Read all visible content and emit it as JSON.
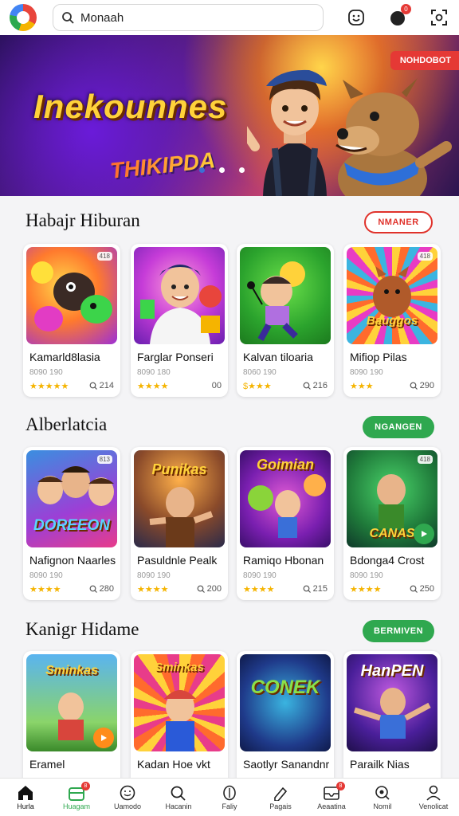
{
  "search": {
    "value": "Monaah"
  },
  "header": {
    "badge_count": "0"
  },
  "hero": {
    "title": "Inekounnes",
    "subtitle": "THIKIPDA",
    "tag": "NOHDOBOT"
  },
  "sections": [
    {
      "title": "Habajr Hiburan",
      "button": "NMANER",
      "button_style": "red",
      "cards": [
        {
          "title": "Kamarld8lasia",
          "meta": "8090 190",
          "stars": "★★★★★",
          "views": "214",
          "corner": "418"
        },
        {
          "title": "Farglar Ponseri",
          "meta": "8090 180",
          "stars": "★★★★",
          "views": "00",
          "corner": ""
        },
        {
          "title": "Kalvan tiloaria",
          "meta": "8060 190",
          "stars": "$★★★",
          "views": "216",
          "corner": ""
        },
        {
          "title": "Mifiop Pilas",
          "meta": "8090 190",
          "stars": "★★★",
          "views": "290",
          "corner": "418"
        }
      ]
    },
    {
      "title": "Alberlatcia",
      "button": "NGANGEN",
      "button_style": "green",
      "cards": [
        {
          "title": "Nafignon Naarles",
          "meta": "8090 190",
          "stars": "★★★★",
          "views": "280",
          "corner": "813"
        },
        {
          "title": "Pasuldnle Pealk",
          "meta": "8090 190",
          "stars": "★★★★",
          "views": "200",
          "corner": ""
        },
        {
          "title": "Ramiqo Hbonan",
          "meta": "8090 190",
          "stars": "★★★★",
          "views": "215",
          "corner": ""
        },
        {
          "title": "Bdonga4 Crost",
          "meta": "8090 190",
          "stars": "★★★★",
          "views": "250",
          "corner": "418"
        }
      ]
    },
    {
      "title": "Kanigr Hidame",
      "button": "BERMIVEN",
      "button_style": "green",
      "cards": [
        {
          "title": "Eramel",
          "meta": "",
          "stars": "",
          "views": "",
          "corner": ""
        },
        {
          "title": "Kadan Hoe vkt",
          "meta": "",
          "stars": "",
          "views": "",
          "corner": ""
        },
        {
          "title": "Saotlyr Sanandnr",
          "meta": "",
          "stars": "",
          "views": "",
          "corner": ""
        },
        {
          "title": "Parailk Nias",
          "meta": "",
          "stars": "",
          "views": "",
          "corner": ""
        }
      ]
    }
  ],
  "thumb_logos": [
    "",
    "",
    "",
    "Bauggos",
    "DOREEON",
    "Punikas",
    "Goimian",
    "CANAS",
    "Sminkas",
    "Sminkas",
    "CONEK",
    "HanPEN"
  ],
  "bottom_nav": [
    {
      "label": "Hurla",
      "icon": "home-icon",
      "badge": ""
    },
    {
      "label": "Huagam",
      "icon": "gift-icon",
      "badge": "8"
    },
    {
      "label": "Uamodo",
      "icon": "smile-icon",
      "badge": ""
    },
    {
      "label": "Hacanin",
      "icon": "search-icon",
      "badge": ""
    },
    {
      "label": "Faliy",
      "icon": "shield-icon",
      "badge": ""
    },
    {
      "label": "Pagais",
      "icon": "pen-icon",
      "badge": ""
    },
    {
      "label": "Aeaatina",
      "icon": "inbox-icon",
      "badge": "8"
    },
    {
      "label": "Nomil",
      "icon": "magnifier-icon",
      "badge": ""
    },
    {
      "label": "Venolicat",
      "icon": "user-icon",
      "badge": ""
    }
  ]
}
